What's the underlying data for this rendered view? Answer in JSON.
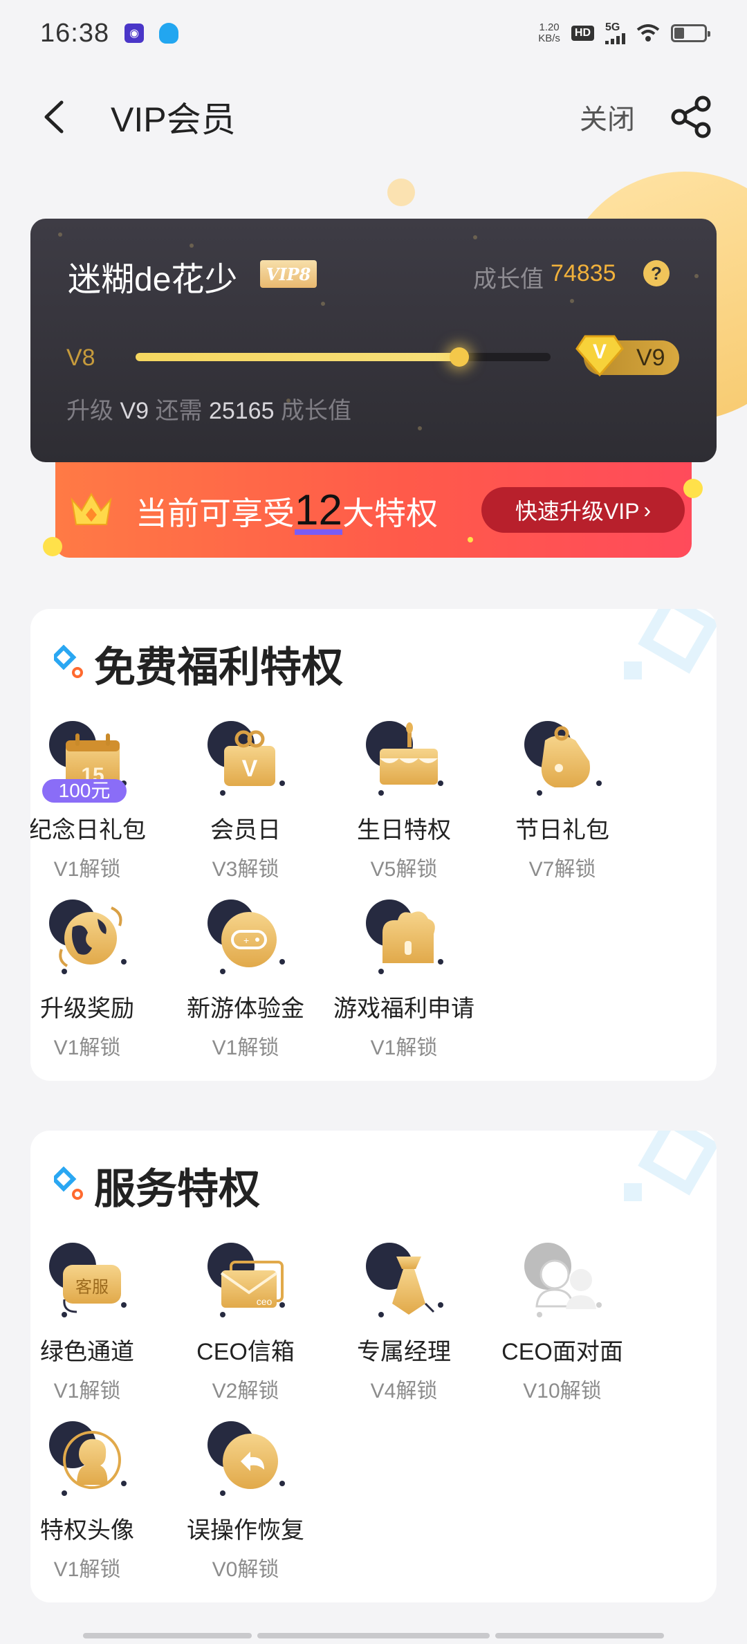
{
  "status_bar": {
    "time": "16:38",
    "net_speed_value": "1.20",
    "net_speed_unit": "KB/s",
    "hd": "HD",
    "network": "5G",
    "icons": [
      "app-notification-icon",
      "qq-icon",
      "signal-icon",
      "wifi-icon",
      "battery-icon"
    ]
  },
  "header": {
    "title": "VIP会员",
    "close_label": "关闭"
  },
  "vip_card": {
    "username": "迷糊de花少",
    "vip_badge": "VIP8",
    "growth_label": "成长值",
    "growth_value": "74835",
    "help": "?",
    "level_from": "V8",
    "level_to": "V9",
    "progress": 0.78,
    "upgrade_prefix": "升级",
    "upgrade_level": "V9",
    "upgrade_mid": "还需",
    "upgrade_needed": "25165",
    "upgrade_suffix": "成长值"
  },
  "privilege_banner": {
    "prefix": "当前可享受",
    "count": "12",
    "suffix": "大特权",
    "button_label": "快速升级VIP",
    "button_arrow": "›"
  },
  "free_section": {
    "title": "免费福利特权",
    "items": [
      {
        "label": "纪念日礼包",
        "unlock": "V1解锁",
        "tag": "100元",
        "calendar_day": "15",
        "icon": "calendar-gift-icon",
        "locked": false
      },
      {
        "label": "会员日",
        "unlock": "V3解锁",
        "glyph": "V",
        "icon": "member-day-gift-icon",
        "locked": false
      },
      {
        "label": "生日特权",
        "unlock": "V5解锁",
        "icon": "birthday-cake-icon",
        "locked": false
      },
      {
        "label": "节日礼包",
        "unlock": "V7解锁",
        "icon": "festival-bag-icon",
        "locked": false
      },
      {
        "label": "升级奖励",
        "unlock": "V1解锁",
        "icon": "globe-reward-icon",
        "locked": false
      },
      {
        "label": "新游体验金",
        "unlock": "V1解锁",
        "icon": "gamepad-icon",
        "locked": false
      },
      {
        "label": "游戏福利申请",
        "unlock": "V1解锁",
        "icon": "game-gift-box-icon",
        "locked": false
      }
    ]
  },
  "service_section": {
    "title": "服务特权",
    "items": [
      {
        "label": "绿色通道",
        "unlock": "V1解锁",
        "glyph": "客服",
        "icon": "customer-service-icon",
        "locked": false
      },
      {
        "label": "CEO信箱",
        "unlock": "V2解锁",
        "glyph": "ceo",
        "icon": "ceo-mailbox-icon",
        "locked": false
      },
      {
        "label": "专属经理",
        "unlock": "V4解锁",
        "icon": "manager-tie-icon",
        "locked": false
      },
      {
        "label": "CEO面对面",
        "unlock": "V10解锁",
        "icon": "face-to-face-icon",
        "locked": true
      },
      {
        "label": "特权头像",
        "unlock": "V1解锁",
        "icon": "avatar-frame-icon",
        "locked": false
      },
      {
        "label": "误操作恢复",
        "unlock": "V0解锁",
        "icon": "undo-recovery-icon",
        "locked": false
      }
    ]
  },
  "colors": {
    "gold": "#f1b13b",
    "banner_red": "#ff5a4a",
    "button_red": "#b8202c",
    "card_dark": "#35343a",
    "accent_purple": "#7a5cf5"
  }
}
